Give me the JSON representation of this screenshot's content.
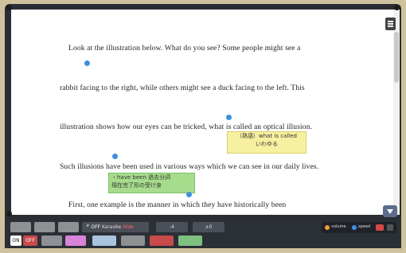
{
  "reader": {
    "lines": [
      "Look at the illustration below.  What do you see?  Some people might see a",
      "rabbit facing to the right, while others might see a duck facing to the left.  This",
      "illustration shows how our eyes can be tricked, what is called an optical illusion.",
      "Such illusions have been used in various ways which we can see in our daily lives.",
      "First, one example is the manner in which they have historically been"
    ],
    "note_yellow": {
      "line1": "（熟語）what is called",
      "line2": "いわゆる"
    },
    "note_green": {
      "line1": "・have been 過去分詞",
      "line2": "現在完了形の受け身"
    }
  },
  "toolbar": {
    "toggle_on": "ON",
    "toggle_off": "OFF",
    "mic_off": "OFF",
    "karaoke": "Karaoke",
    "hide": "Hide",
    "step_back": "-4",
    "step_zero": "±0",
    "volume": "volume",
    "speed": "speed"
  },
  "colors": {
    "marker": "#3f8fe0",
    "highlight_yellow": "#f7f0a0",
    "highlight_green": "#a6dc8c",
    "toolbar_bg": "#2b2f36"
  }
}
